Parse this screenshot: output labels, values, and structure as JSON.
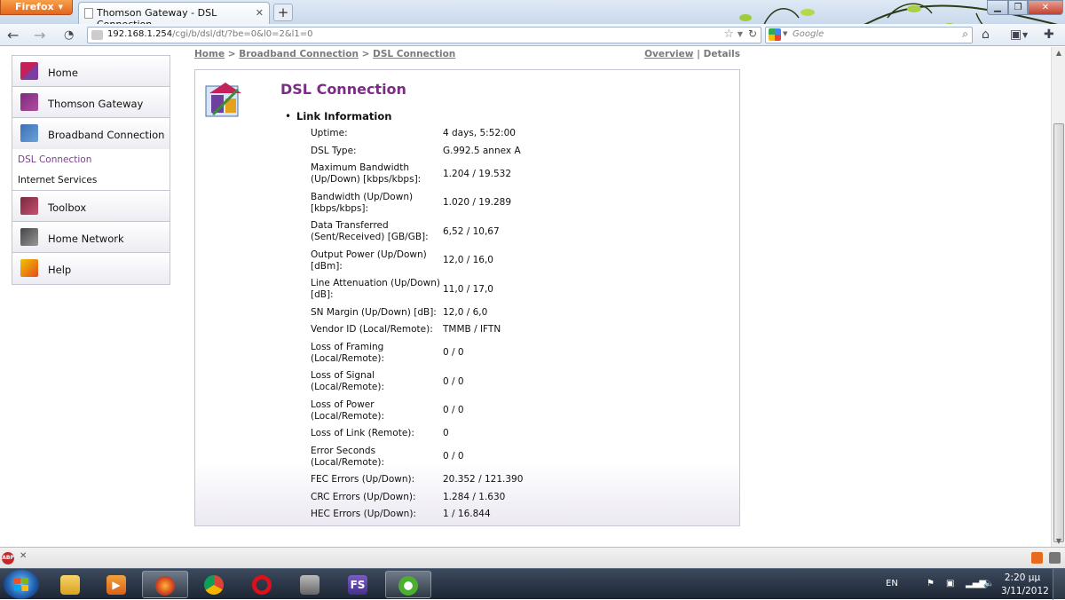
{
  "browser": {
    "menu_button": "Firefox",
    "tab_title": "Thomson Gateway - DSL Connection",
    "url_host": "192.168.1.254",
    "url_path": "/cgi/b/dsl/dt/?be=0&l0=2&l1=0",
    "search_placeholder": "Google"
  },
  "breadcrumb": {
    "home": "Home",
    "broadband": "Broadband Connection",
    "current": "DSL Connection",
    "sep": ">",
    "overview": "Overview",
    "pipe": "|",
    "details": "Details"
  },
  "sidebar": {
    "home": "Home",
    "gateway": "Thomson Gateway",
    "broadband": "Broadband Connection",
    "sub_dsl": "DSL Connection",
    "sub_internet": "Internet Services",
    "toolbox": "Toolbox",
    "home_network": "Home Network",
    "help": "Help"
  },
  "panel": {
    "title": "DSL Connection",
    "section": "Link Information",
    "rows": [
      {
        "label": "Uptime:",
        "value": "4 days, 5:52:00"
      },
      {
        "label": "DSL Type:",
        "value": "G.992.5 annex A"
      },
      {
        "label": "Maximum Bandwidth (Up/Down) [kbps/kbps]:",
        "value": "1.204 / 19.532"
      },
      {
        "label": "Bandwidth (Up/Down) [kbps/kbps]:",
        "value": "1.020 / 19.289"
      },
      {
        "label": "Data Transferred (Sent/Received) [GB/GB]:",
        "value": "6,52 / 10,67"
      },
      {
        "label": "Output Power (Up/Down) [dBm]:",
        "value": "12,0 / 16,0"
      },
      {
        "label": "Line Attenuation (Up/Down) [dB]:",
        "value": "11,0 / 17,0"
      },
      {
        "label": "SN Margin (Up/Down) [dB]:",
        "value": "12,0 / 6,0"
      },
      {
        "label": "Vendor ID (Local/Remote):",
        "value": "TMMB / IFTN"
      },
      {
        "label": "Loss of Framing (Local/Remote):",
        "value": "0 / 0"
      },
      {
        "label": "Loss of Signal (Local/Remote):",
        "value": "0 / 0"
      },
      {
        "label": "Loss of Power (Local/Remote):",
        "value": "0 / 0"
      },
      {
        "label": "Loss of Link (Remote):",
        "value": "0"
      },
      {
        "label": "Error Seconds (Local/Remote):",
        "value": "0 / 0"
      },
      {
        "label": "FEC Errors (Up/Down):",
        "value": "20.352 / 121.390"
      },
      {
        "label": "CRC Errors (Up/Down):",
        "value": "1.284 / 1.630"
      },
      {
        "label": "HEC Errors (Up/Down):",
        "value": "1 / 16.844"
      }
    ]
  },
  "addon_bar": {
    "abp_label": "ABP"
  },
  "taskbar": {
    "fs_label": "FS",
    "language": "EN",
    "time": "2:20 μμ",
    "date": "3/11/2012"
  }
}
